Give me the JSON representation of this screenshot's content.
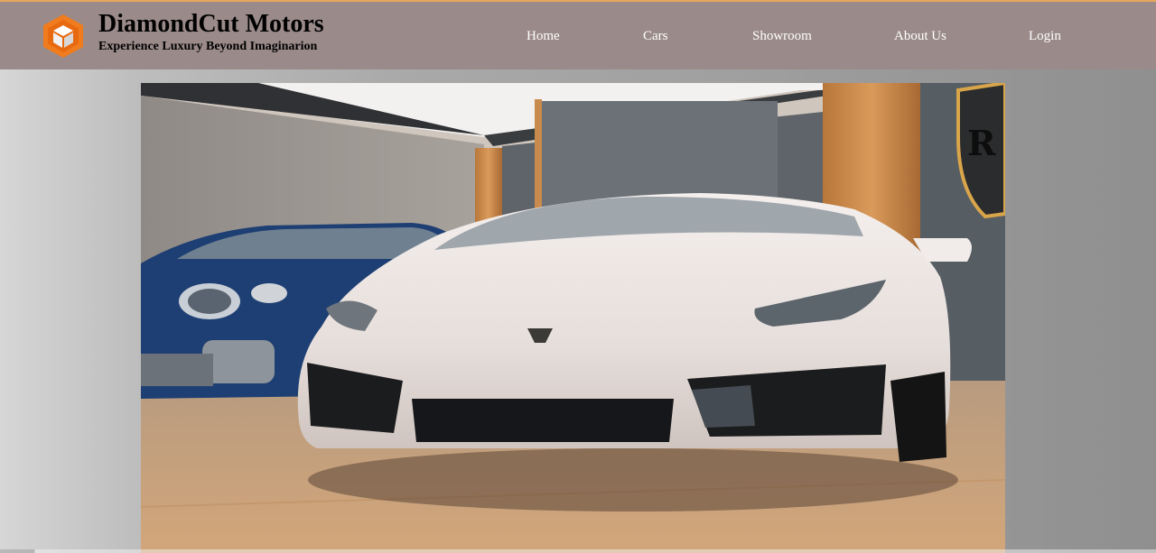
{
  "brand": {
    "title": "DiamondCut Motors",
    "tagline": "Experience Luxury Beyond Imaginarion",
    "logo_icon": "hexagon-cube-logo-icon",
    "accent": "#f07c1e"
  },
  "nav": {
    "items": [
      {
        "label": "Home"
      },
      {
        "label": "Cars"
      },
      {
        "label": "Showroom"
      },
      {
        "label": "About Us"
      },
      {
        "label": "Login"
      }
    ]
  },
  "hero": {
    "image": "showroom-supercar-photo"
  },
  "colors": {
    "header_bg": "#9a8b8a",
    "nav_text": "#ffffff"
  }
}
